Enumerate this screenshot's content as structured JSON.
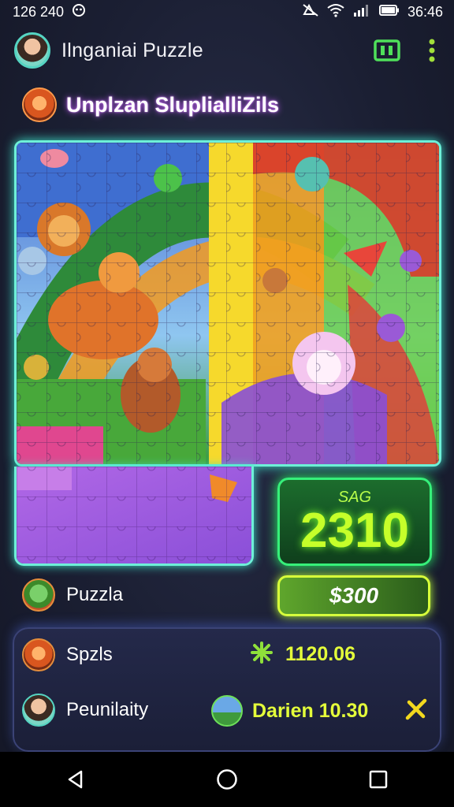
{
  "status_bar": {
    "time_left": "126 240",
    "time_right": "36:46"
  },
  "header": {
    "title": "Ilnganiai Puzzle"
  },
  "subheader": {
    "title": "Unplzan SluplialliZils"
  },
  "score_box": {
    "label": "SAG",
    "value": "2310"
  },
  "puzzle_row": {
    "label": "Puzzla",
    "price": "$300"
  },
  "stats": {
    "row1": {
      "label": "Spzls",
      "value": "1120.06"
    },
    "row2": {
      "label": "Peunilaity",
      "value": "Darien 10.30"
    }
  },
  "colors": {
    "accent_teal": "#6ef0d8",
    "score_green": "#36f07a",
    "value_yellow": "#e4ff3a"
  },
  "icons": [
    "battery-icon",
    "wifi-icon",
    "signal-icon",
    "mute-icon",
    "puzzle-grid-icon",
    "more-vertical-icon",
    "star-icon",
    "close-icon",
    "back-icon",
    "home-icon",
    "recents-icon"
  ]
}
